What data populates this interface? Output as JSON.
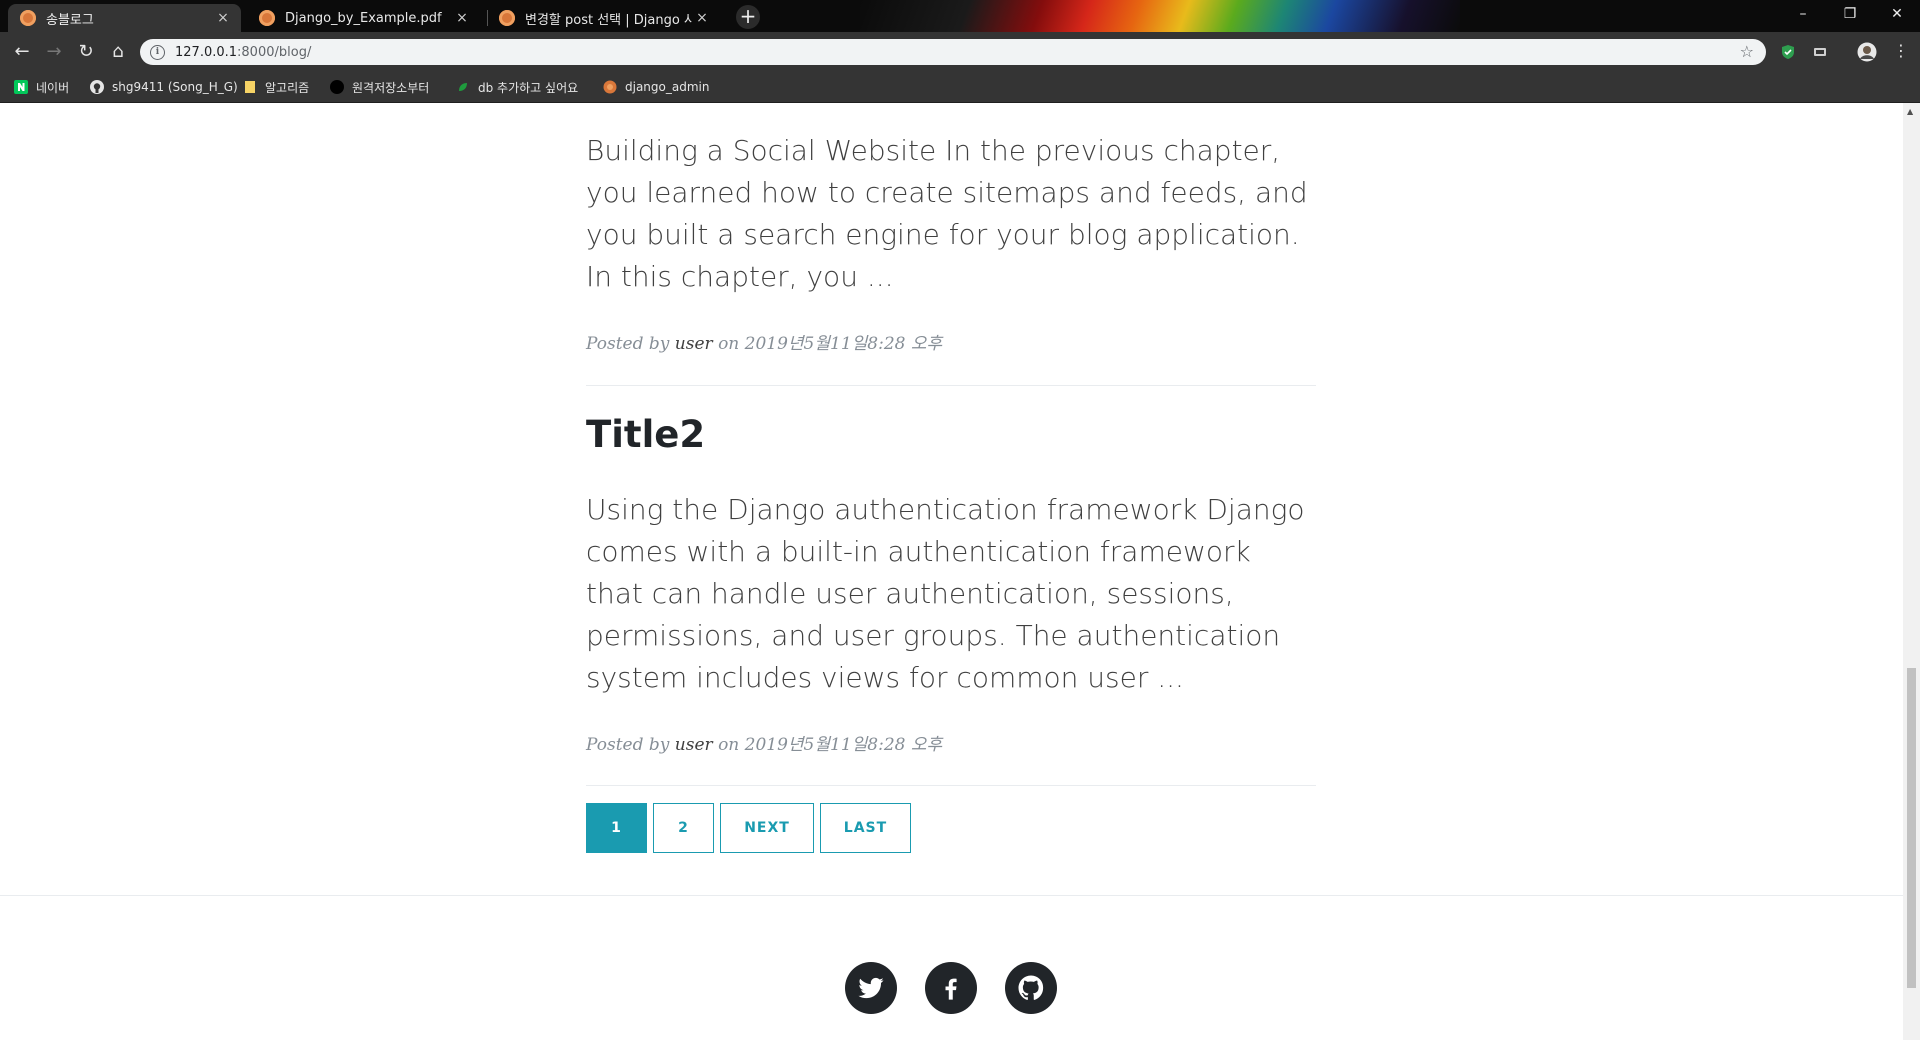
{
  "tabs": [
    {
      "title": "송블로그",
      "close": "×"
    },
    {
      "title": "Django_by_Example.pdf",
      "close": "×"
    },
    {
      "title": "변경할 post 선택 | Django 사이트",
      "close": "×"
    }
  ],
  "new_tab": "+",
  "window_controls": {
    "minimize": "–",
    "restore": "❐",
    "close": "✕"
  },
  "toolbar": {
    "back": "←",
    "forward": "→",
    "reload": "↻",
    "home": "⌂",
    "url_host": "127.0.0.1",
    "url_rest": ":8000/blog/",
    "info": "i",
    "star": "☆",
    "menu": "⋮"
  },
  "bookmarks": [
    {
      "label": "네이버",
      "icon": "naver-icon"
    },
    {
      "label": "shg9411 (Song_H_G)",
      "icon": "github-icon"
    },
    {
      "label": "알고리즘",
      "icon": "folder-icon"
    },
    {
      "label": "원격저장소부터",
      "icon": "circle-icon"
    },
    {
      "label": "db 추가하고 싶어요",
      "icon": "leaf-icon"
    },
    {
      "label": "django_admin",
      "icon": "django-icon"
    }
  ],
  "posts": [
    {
      "title": "",
      "excerpt": "Building a Social Website In the previous chapter, you learned how to create sitemaps and feeds, and you built a search engine for your blog application. In this chapter, you ...",
      "posted_by": "Posted by",
      "author": "user",
      "on": "on 2019년5월11일8:28 오후"
    },
    {
      "title": "Title2",
      "excerpt": "Using the Django authentication framework Django comes with a built-in authentication framework that can handle user authentication, sessions, permissions, and user groups. The authentication system includes views for common user ...",
      "posted_by": "Posted by",
      "author": "user",
      "on": "on 2019년5월11일8:28 오후"
    }
  ],
  "pagination": [
    "1",
    "2",
    "NEXT",
    "LAST"
  ],
  "pagination_active": "1",
  "social": [
    "twitter-icon",
    "facebook-icon",
    "github-icon"
  ],
  "colors": {
    "accent": "#1a9bb0",
    "text": "#404040",
    "muted": "#868e96",
    "heading": "#212529"
  }
}
